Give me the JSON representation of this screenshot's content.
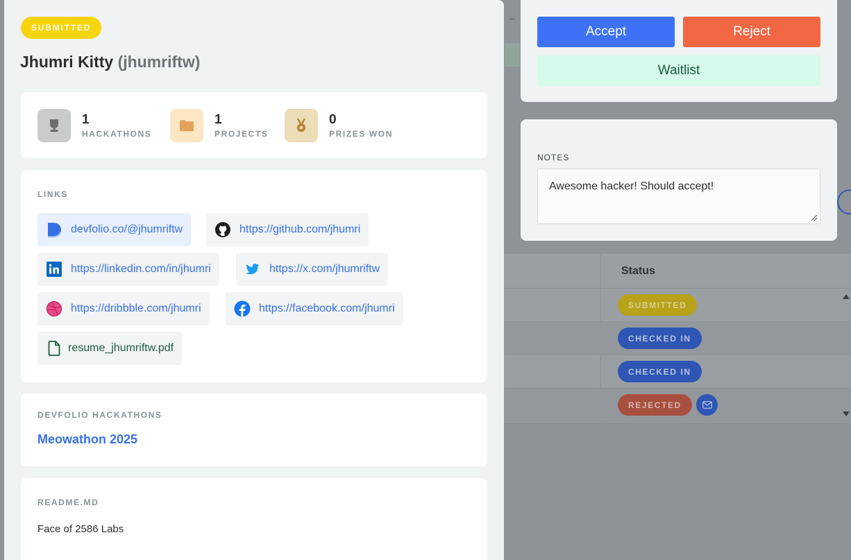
{
  "background_table": {
    "status_header": "Status",
    "rows": [
      {
        "status": "SUBMITTED",
        "kind": "submitted"
      },
      {
        "status": "CHECKED IN",
        "kind": "checked"
      },
      {
        "status": "CHECKED IN",
        "kind": "checked"
      },
      {
        "status": "REJECTED",
        "kind": "rejected"
      }
    ]
  },
  "applicant": {
    "status": "SUBMITTED",
    "name": "Jhumri Kitty",
    "handle": "(jhumriftw)"
  },
  "stats": [
    {
      "value": "1",
      "label": "HACKATHONS",
      "icon": "trophy-icon"
    },
    {
      "value": "1",
      "label": "PROJECTS",
      "icon": "folder-icon"
    },
    {
      "value": "0",
      "label": "PRIZES WON",
      "icon": "medal-icon"
    }
  ],
  "links": {
    "label": "LINKS",
    "devfolio": "devfolio.co/@jhumriftw",
    "github": "https://github.com/jhumri",
    "linkedin": "https://linkedin.com/in/jhumri",
    "twitter": "https://x.com/jhumriftw",
    "dribbble": "https://dribbble.com/jhumri",
    "facebook": "https://facebook.com/jhumri",
    "resume": "resume_jhumriftw.pdf"
  },
  "hackathons": {
    "label": "DEVFOLIO HACKATHONS",
    "items": [
      "Meowathon 2025"
    ]
  },
  "readme": {
    "label": "README.MD",
    "text": "Face of 2586 Labs"
  },
  "actions": {
    "accept": "Accept",
    "reject": "Reject",
    "waitlist": "Waitlist"
  },
  "notes": {
    "label": "NOTES",
    "value": "Awesome hacker! Should accept!"
  },
  "colors": {
    "accent": "#3d72f6",
    "reject": "#f26743",
    "waitlist": "#d6fbeb",
    "submitted": "#f7d40e"
  }
}
